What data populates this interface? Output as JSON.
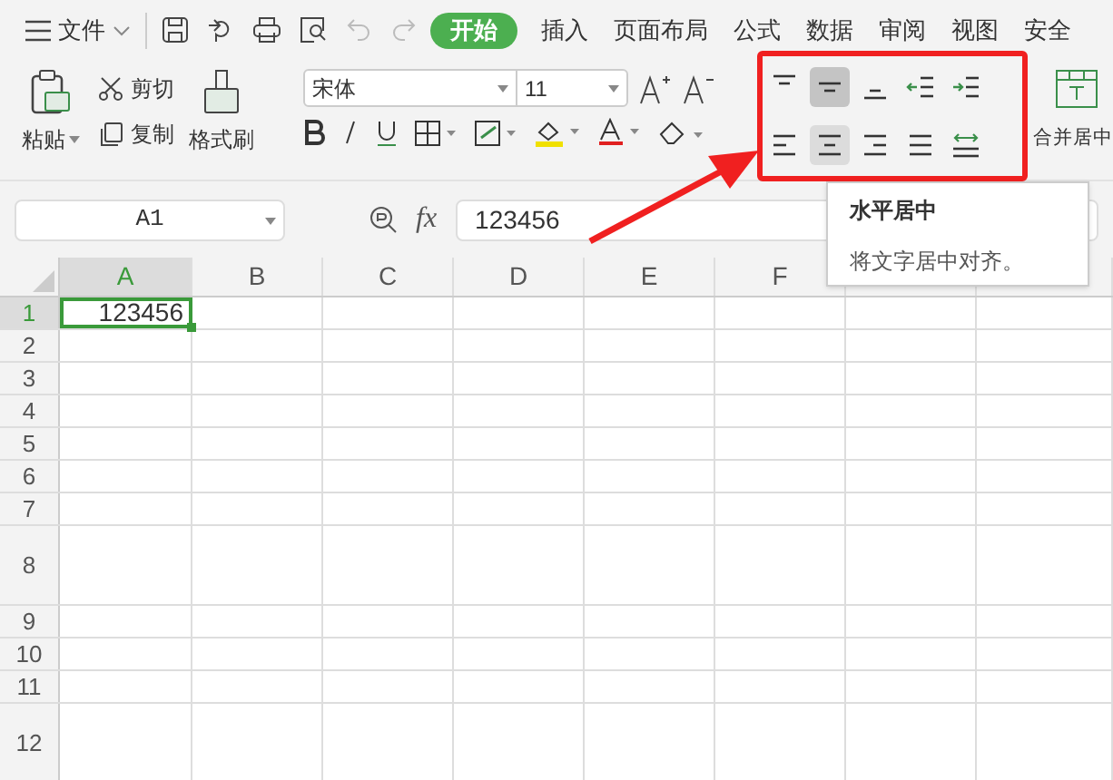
{
  "menu": {
    "label": "文件"
  },
  "tabs": [
    {
      "label": "开始",
      "selected": true
    },
    {
      "label": "插入",
      "selected": false
    },
    {
      "label": "页面布局",
      "selected": false
    },
    {
      "label": "公式",
      "selected": false
    },
    {
      "label": "数据",
      "selected": false
    },
    {
      "label": "审阅",
      "selected": false
    },
    {
      "label": "视图",
      "selected": false
    },
    {
      "label": "安全",
      "selected": false
    }
  ],
  "clipboard": {
    "paste": "粘贴",
    "cut": "剪切",
    "copy": "复制",
    "format_painter": "格式刷"
  },
  "font": {
    "name": "宋体",
    "size": "11"
  },
  "align_buttons": [
    {
      "kind": "top",
      "selected": false,
      "hovered": false
    },
    {
      "kind": "middle",
      "selected": true,
      "hovered": false
    },
    {
      "kind": "bottom",
      "selected": false,
      "hovered": false
    },
    {
      "kind": "outdent",
      "selected": false,
      "hovered": false
    },
    {
      "kind": "indent",
      "selected": false,
      "hovered": false
    },
    {
      "kind": "left",
      "selected": false,
      "hovered": false
    },
    {
      "kind": "center",
      "selected": false,
      "hovered": true
    },
    {
      "kind": "right",
      "selected": false,
      "hovered": false
    },
    {
      "kind": "justify",
      "selected": false,
      "hovered": false
    },
    {
      "kind": "distributed",
      "selected": false,
      "hovered": false
    }
  ],
  "merge": {
    "label": "合并居中"
  },
  "tooltip": {
    "title": "水平居中",
    "text": "将文字居中对齐。"
  },
  "formula_bar": {
    "name_box": "A1",
    "fx": "fx",
    "value": "123456"
  },
  "columns": [
    {
      "label": "A",
      "selected": true
    },
    {
      "label": "B",
      "selected": false
    },
    {
      "label": "C",
      "selected": false
    },
    {
      "label": "D",
      "selected": false
    },
    {
      "label": "E",
      "selected": false
    },
    {
      "label": "F",
      "selected": false
    }
  ],
  "rows": [
    {
      "label": "1",
      "tall": false,
      "selected": true,
      "cells": [
        "123456"
      ]
    },
    {
      "label": "2",
      "tall": false,
      "selected": false,
      "cells": []
    },
    {
      "label": "3",
      "tall": false,
      "selected": false,
      "cells": []
    },
    {
      "label": "4",
      "tall": false,
      "selected": false,
      "cells": []
    },
    {
      "label": "5",
      "tall": false,
      "selected": false,
      "cells": []
    },
    {
      "label": "6",
      "tall": false,
      "selected": false,
      "cells": []
    },
    {
      "label": "7",
      "tall": false,
      "selected": false,
      "cells": []
    },
    {
      "label": "8",
      "tall": true,
      "selected": false,
      "cells": []
    },
    {
      "label": "9",
      "tall": false,
      "selected": false,
      "cells": []
    },
    {
      "label": "10",
      "tall": false,
      "selected": false,
      "cells": []
    },
    {
      "label": "11",
      "tall": false,
      "selected": false,
      "cells": []
    },
    {
      "label": "12",
      "tall": true,
      "selected": false,
      "cells": []
    }
  ]
}
